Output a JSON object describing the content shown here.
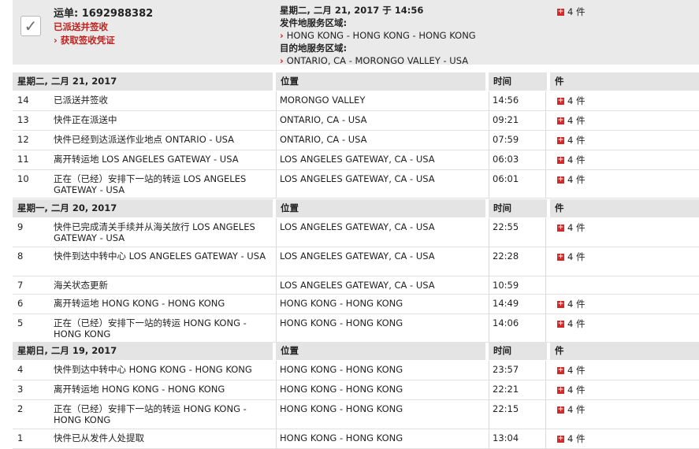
{
  "summary": {
    "waybill": "运单: 1692988382",
    "status": "已派送并签收",
    "proof_link": "获取签收凭证",
    "date": "星期二, 二月 21, 2017 于 14:56",
    "origin_label": "发件地服务区域:",
    "origin": "HONG KONG - HONG KONG - HONG KONG",
    "dest_label": "目的地服务区域:",
    "destination": "ONTARIO, CA - MORONGO VALLEY - USA",
    "pieces": "4 件"
  },
  "headers": {
    "location": "位置",
    "time": "时间",
    "pieces": "件"
  },
  "groups": [
    {
      "date": "星期二, 二月 21, 2017",
      "rows": [
        {
          "n": "14",
          "desc": "已派送并签收",
          "loc": "MORONGO VALLEY",
          "time": "14:56",
          "pcs": "4 件"
        },
        {
          "n": "13",
          "desc": "快件正在派送中",
          "loc": "ONTARIO, CA - USA",
          "time": "09:21",
          "pcs": "4 件"
        },
        {
          "n": "12",
          "desc": "快件已经到达派送作业地点 ONTARIO - USA",
          "loc": "ONTARIO, CA - USA",
          "time": "07:59",
          "pcs": "4 件"
        },
        {
          "n": "11",
          "desc": "离开转运地 LOS ANGELES GATEWAY - USA",
          "loc": "LOS ANGELES GATEWAY, CA - USA",
          "time": "06:03",
          "pcs": "4 件"
        },
        {
          "n": "10",
          "desc": "正在（已经）安排下一站的转运 LOS ANGELES GATEWAY - USA",
          "loc": "LOS ANGELES GATEWAY, CA - USA",
          "time": "06:01",
          "pcs": "4 件"
        }
      ]
    },
    {
      "date": "星期一, 二月 20, 2017",
      "rows": [
        {
          "n": "9",
          "desc": "快件已完成清关手续并从海关放行 LOS ANGELES GATEWAY - USA",
          "loc": "LOS ANGELES GATEWAY, CA - USA",
          "time": "22:55",
          "pcs": "4 件"
        },
        {
          "n": "8",
          "desc": "快件到达中转中心 LOS ANGELES GATEWAY - USA",
          "loc": "LOS ANGELES GATEWAY, CA - USA",
          "time": "22:28",
          "pcs": "4 件"
        },
        {
          "n": "7",
          "desc": "海关状态更新",
          "loc": "LOS ANGELES GATEWAY, CA - USA",
          "time": "10:59",
          "pcs": ""
        },
        {
          "n": "6",
          "desc": "离开转运地 HONG KONG - HONG KONG",
          "loc": "HONG KONG - HONG KONG",
          "time": "14:49",
          "pcs": "4 件"
        },
        {
          "n": "5",
          "desc": "正在（已经）安排下一站的转运 HONG KONG - HONG KONG",
          "loc": "HONG KONG - HONG KONG",
          "time": "14:06",
          "pcs": "4 件"
        }
      ]
    },
    {
      "date": "星期日, 二月 19, 2017",
      "rows": [
        {
          "n": "4",
          "desc": "快件到达中转中心 HONG KONG - HONG KONG",
          "loc": "HONG KONG - HONG KONG",
          "time": "23:57",
          "pcs": "4 件"
        },
        {
          "n": "3",
          "desc": "离开转运地 HONG KONG - HONG KONG",
          "loc": "HONG KONG - HONG KONG",
          "time": "22:21",
          "pcs": "4 件"
        },
        {
          "n": "2",
          "desc": "正在（已经）安排下一站的转运 HONG KONG - HONG KONG",
          "loc": "HONG KONG - HONG KONG",
          "time": "22:15",
          "pcs": "4 件"
        },
        {
          "n": "1",
          "desc": "快件已从发件人处提取",
          "loc": "HONG KONG - HONG KONG",
          "time": "13:04",
          "pcs": "4 件"
        }
      ]
    }
  ]
}
